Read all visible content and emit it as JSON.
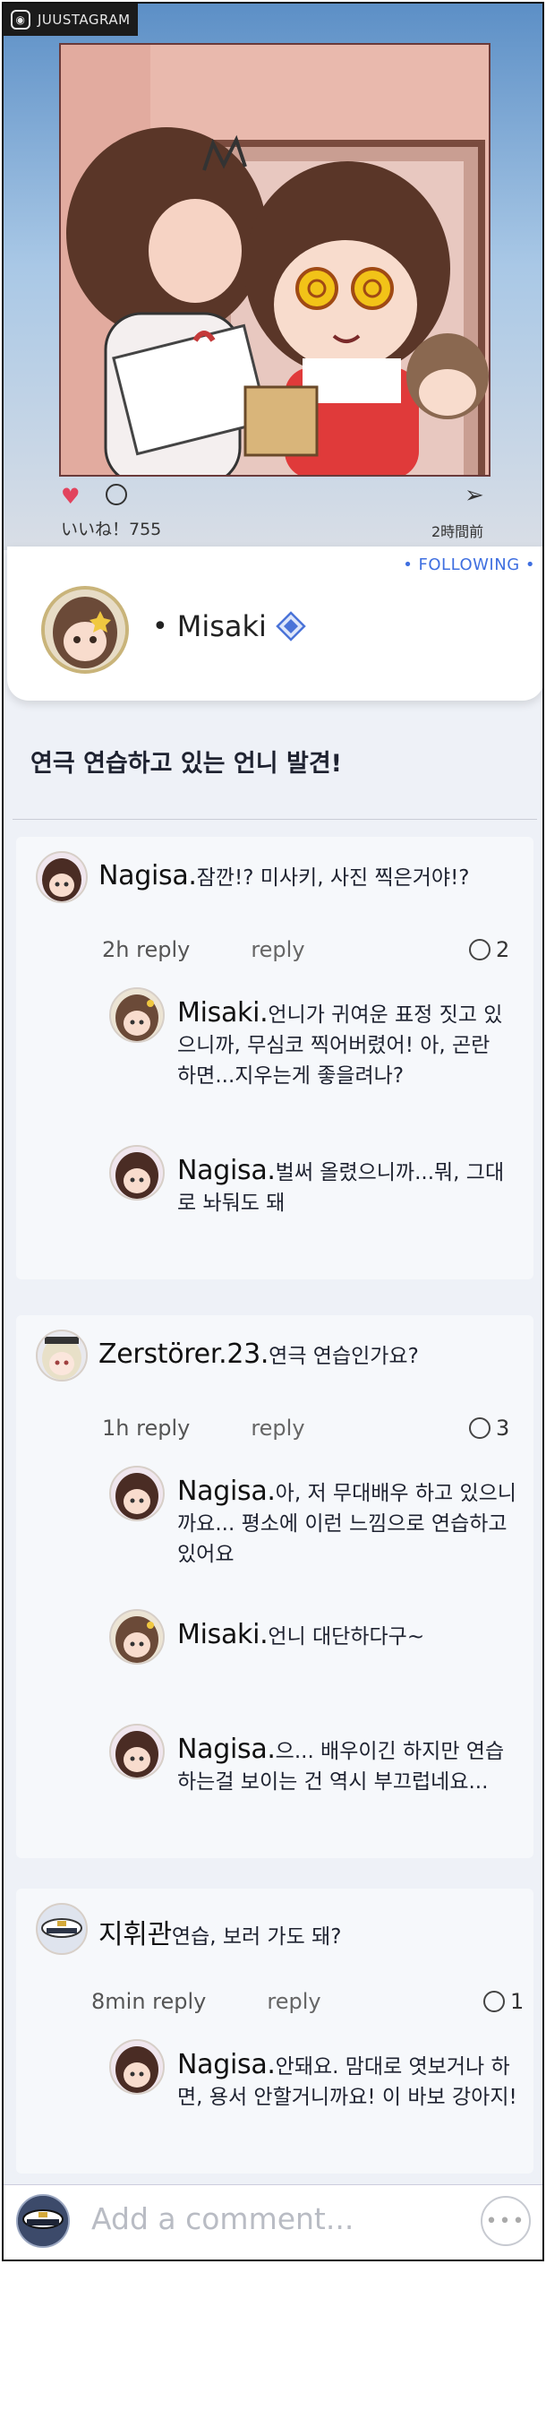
{
  "app_badge": "JUUSTAGRAM",
  "post": {
    "likes": "いいね！755",
    "time": "2時間前",
    "following": "• FOLLOWING •",
    "author": "Misaki",
    "caption": "연극 연습하고 있는 언니 발견!"
  },
  "threads": [
    {
      "comment": {
        "name": "Nagisa.",
        "text": "잠깐!? 미사키, 사진 찍은거야!?"
      },
      "meta": {
        "time": "2h reply",
        "reply": "reply",
        "count": "2"
      },
      "replies": [
        {
          "name": "Misaki.",
          "text": "언니가 귀여운 표정 짓고 있으니까, 무심코 찍어버렸어! 아, 곤란하면...지우는게 좋을려나?"
        },
        {
          "name": "Nagisa.",
          "text": "벌써 올렸으니까...뭐, 그대로 놔둬도 돼"
        }
      ]
    },
    {
      "comment": {
        "name": "Zerstörer.23.",
        "text": "연극 연습인가요?"
      },
      "meta": {
        "time": "1h reply",
        "reply": "reply",
        "count": "3"
      },
      "replies": [
        {
          "name": "Nagisa.",
          "text": "아, 저 무대배우 하고 있으니까요... 평소에 이런 느낌으로 연습하고 있어요"
        },
        {
          "name": "Misaki.",
          "text": "언니 대단하다구~"
        },
        {
          "name": "Nagisa.",
          "text": "으... 배우이긴 하지만 연습하는걸 보이는 건 역시 부끄럽네요..."
        }
      ]
    },
    {
      "comment": {
        "name": "지휘관",
        "text": "연습, 보러 가도 돼?"
      },
      "meta": {
        "time": "8min reply",
        "reply": "reply",
        "count": "1"
      },
      "replies": [
        {
          "name": "Nagisa.",
          "text": "안돼요. 맘대로 엿보거나 하면, 용서 안할거니까요! 이 바보 강아지!"
        }
      ]
    }
  ],
  "bottom_bar": {
    "placeholder": "Add a comment...",
    "chat_icon": "•••"
  },
  "colors": {
    "accent": "#3f6fe0",
    "heart": "#e2435d",
    "frame": "#111111"
  }
}
